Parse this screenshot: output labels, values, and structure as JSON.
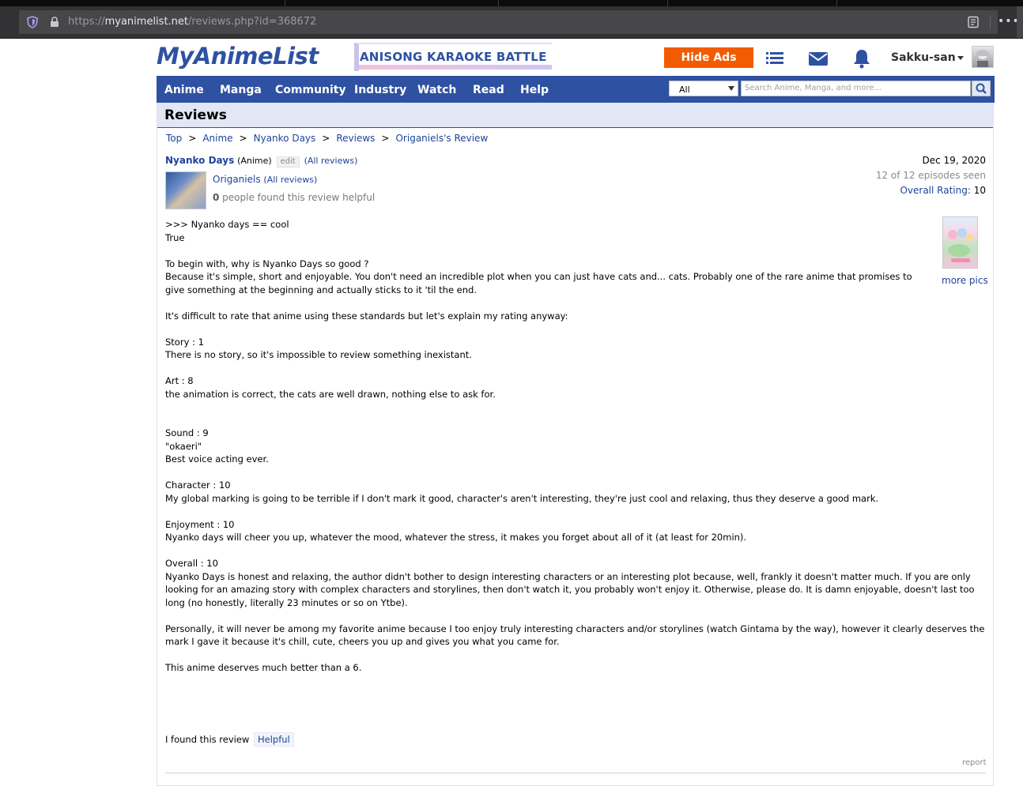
{
  "browser": {
    "url_prefix": "https://",
    "url_host": "myanimelist.net",
    "url_path": "/reviews.php?id=368672",
    "menu": "•••"
  },
  "header": {
    "logo": "MyAnimeList",
    "banner": "ANISONG KARAOKE BATTLE",
    "hide_ads": "Hide Ads",
    "username": "Sakku-san"
  },
  "nav": {
    "items": [
      "Anime",
      "Manga",
      "Community",
      "Industry",
      "Watch",
      "Read",
      "Help"
    ],
    "search_select": "All",
    "search_placeholder": "Search Anime, Manga, and more..."
  },
  "page": {
    "title": "Reviews",
    "breadcrumb": [
      "Top",
      "Anime",
      "Nyanko Days",
      "Reviews",
      "Origaniels's Review"
    ]
  },
  "review": {
    "anime_title": "Nyanko Days",
    "anime_type": "(Anime)",
    "edit": "edit",
    "all_reviews": "(All reviews)",
    "reviewer": "Origaniels",
    "reviewer_all_reviews": "(All reviews)",
    "helpful_count": "0",
    "helpful_text": " people found this review helpful",
    "date": "Dec 19, 2020",
    "episodes": "12 of 12 episodes seen",
    "overall_label": "Overall Rating:",
    "overall_value": "10",
    "more_pics": "more pics",
    "lines": [
      ">>> Nyanko days == cool",
      "True",
      "",
      "To begin with, why is Nyanko Days so good ?",
      "Because it's simple, short and enjoyable. You don't need an incredible plot when you can just have cats and... cats. Probably one of the rare anime that promises to",
      "give something at the beginning and actually sticks to it 'til the end.",
      "",
      "It's difficult to rate that anime using these standards but let's explain my rating anyway:",
      "",
      "Story : 1",
      "There is no story, so it's impossible to review something inexistant.",
      "",
      "Art : 8",
      "the animation is correct, the cats are well drawn, nothing else to ask for.",
      "",
      "",
      "Sound : 9",
      "\"okaeri\"",
      "Best voice acting ever.",
      "",
      "Character : 10",
      "My global marking is going to be terrible if I don't mark it good, character's aren't interesting, they're just cool and relaxing, thus they deserve a good mark.",
      "",
      "Enjoyment : 10",
      "Nyanko days will cheer you up, whatever the mood, whatever the stress, it makes you forget about all of it (at least for 20min).",
      "",
      "Overall : 10",
      "Nyanko Days is honest and relaxing, the author didn't bother to design interesting characters or an interesting plot because, well, frankly it doesn't matter much. If you are only",
      "looking for an amazing story with complex characters and storylines, then don't watch it, you probably won't enjoy it. Otherwise, please do. It is damn enjoyable, doesn't last too",
      "long (no honestly, literally 23 minutes or so on Ytbe).",
      "",
      "Personally, it will never be among my favorite anime because I too enjoy truly interesting characters and/or storylines (watch Gintama by the way), however it clearly deserves the",
      "mark I gave it because it's chill, cute, cheers you up and gives you what you came for.",
      "",
      "This anime deserves much better than a 6."
    ],
    "found_prefix": "I found this review",
    "helpful_button": "Helpful",
    "report": "report"
  },
  "colors": {
    "brand": "#2e51a2",
    "hide_ads": "#f35b00",
    "link": "#1c439b"
  }
}
